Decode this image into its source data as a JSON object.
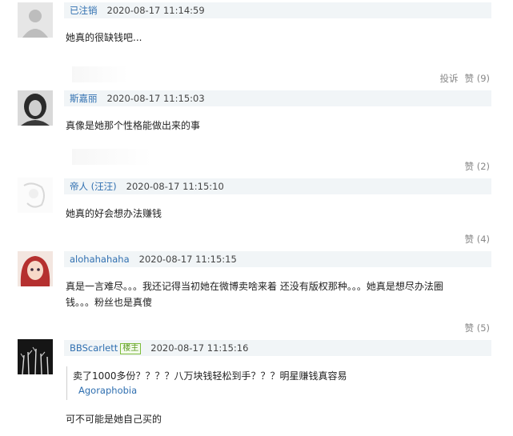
{
  "comments": [
    {
      "user": "已注销",
      "time": "2020-08-17 11:14:59",
      "text": "她真的很缺钱吧...",
      "report": "投诉",
      "like": "赞 (9)"
    },
    {
      "user": "斯嘉丽",
      "time": "2020-08-17 11:15:03",
      "text": "真像是她那个性格能做出来的事",
      "like": "赞 (2)"
    },
    {
      "user": "帝人",
      "nick": "(汪汪)",
      "time": "2020-08-17 11:15:10",
      "text": "她真的好会想办法赚钱",
      "like": "赞 (4)"
    },
    {
      "user": "alohahahaha",
      "time": "2020-08-17 11:15:15",
      "text_line1": "真是一言难尽。。。我还记得当初她在微博卖啥来着 还没有版权那种。。。她真是想尽办法圈",
      "text_line2": "钱。。。粉丝也是真傻",
      "like": "赞 (5)"
    },
    {
      "user": "BBScarlett",
      "badge": "楼主",
      "time": "2020-08-17 11:15:16",
      "quote_text": "卖了1000多份？？？？八万块钱轻松到手？？？明星赚钱真容易",
      "quote_author": "Agoraphobia",
      "text": "可不可能是她自己买的"
    }
  ]
}
